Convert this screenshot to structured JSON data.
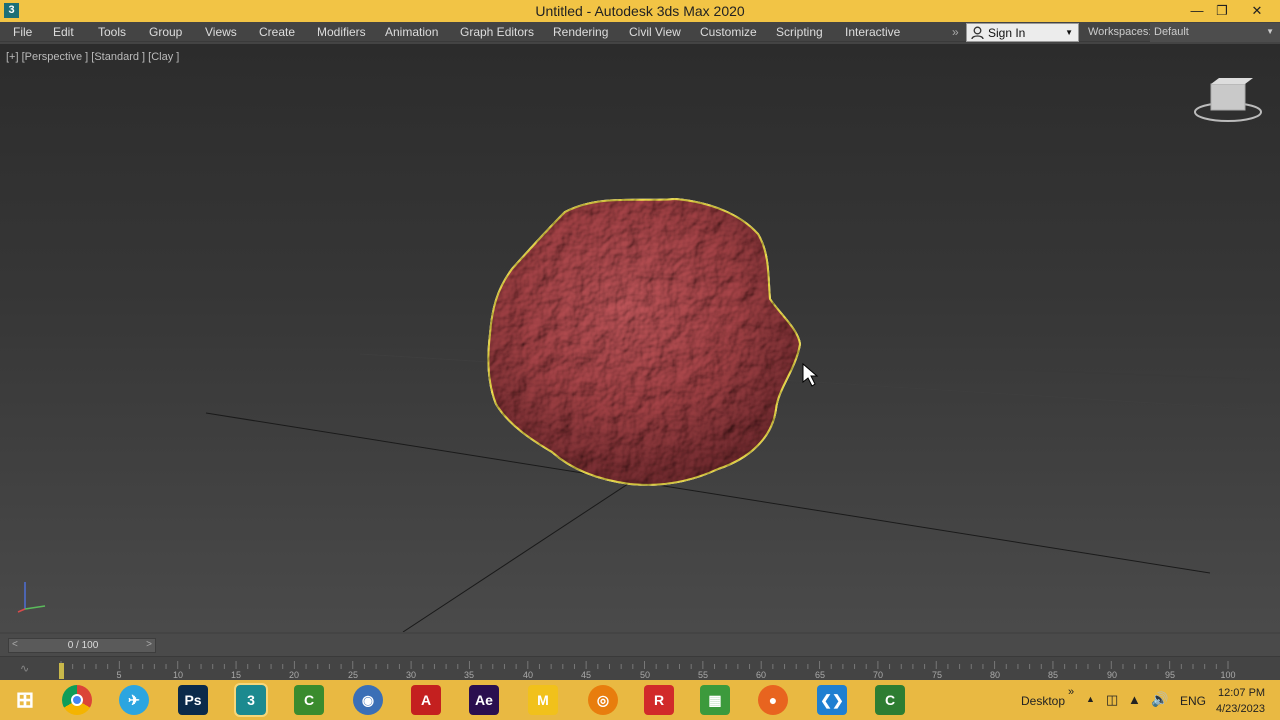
{
  "window": {
    "icon": "3",
    "title": "Untitled - Autodesk 3ds Max 2020",
    "minimize_icon": "minimize-icon",
    "restore_icon": "restore-icon",
    "close_icon": "close-icon"
  },
  "menubar": {
    "items": [
      "File",
      "Edit",
      "Tools",
      "Group",
      "Views",
      "Create",
      "Modifiers",
      "Animation",
      "Graph Editors",
      "Rendering",
      "Civil View",
      "Customize",
      "Scripting",
      "Interactive"
    ],
    "overflow": "»",
    "sign_in": "Sign In",
    "workspaces_label": "Workspaces:",
    "workspace_value": "Default"
  },
  "viewport": {
    "label": "[+] [Perspective ] [Standard ] [Clay ]",
    "object_color": "#b04a4e",
    "selection_color": "#f5e44c"
  },
  "timeline": {
    "frame_display": "0 / 100",
    "prev": "<",
    "next": ">",
    "ticks": [
      "5",
      "10",
      "15",
      "20",
      "25",
      "30",
      "35",
      "40",
      "45",
      "50",
      "55",
      "60",
      "65",
      "70",
      "75",
      "80",
      "85",
      "90",
      "95",
      "100"
    ]
  },
  "taskbar": {
    "apps": [
      {
        "name": "windows-start",
        "glyph": "⊞",
        "color": "transparent"
      },
      {
        "name": "chrome",
        "glyph": "",
        "color": "#db4437"
      },
      {
        "name": "telegram",
        "glyph": "✈",
        "color": "#2ca5e0"
      },
      {
        "name": "photoshop",
        "glyph": "Ps",
        "color": "#0b2a4a"
      },
      {
        "name": "3ds-max",
        "glyph": "3",
        "color": "#1c8a8f"
      },
      {
        "name": "camtasia",
        "glyph": "C",
        "color": "#3a8b2e"
      },
      {
        "name": "globe-app",
        "glyph": "◉",
        "color": "#3b6fb6"
      },
      {
        "name": "autocad",
        "glyph": "A",
        "color": "#c4201f"
      },
      {
        "name": "after-effects",
        "glyph": "Ae",
        "color": "#2a0f4f"
      },
      {
        "name": "m-app",
        "glyph": "M",
        "color": "#f1c11b"
      },
      {
        "name": "blender",
        "glyph": "◎",
        "color": "#e87d0d"
      },
      {
        "name": "revit",
        "glyph": "R",
        "color": "#d12a2a"
      },
      {
        "name": "sheets-app",
        "glyph": "▦",
        "color": "#3c9a3c"
      },
      {
        "name": "firefox",
        "glyph": "●",
        "color": "#e8641f"
      },
      {
        "name": "vscode",
        "glyph": "❮❯",
        "color": "#1f7fd1"
      },
      {
        "name": "camtasia-2",
        "glyph": "C",
        "color": "#2e7d32"
      }
    ],
    "desktop_label": "Desktop",
    "overflow": "»",
    "language": "ENG",
    "time": "12:07 PM",
    "date": "4/23/2023"
  }
}
